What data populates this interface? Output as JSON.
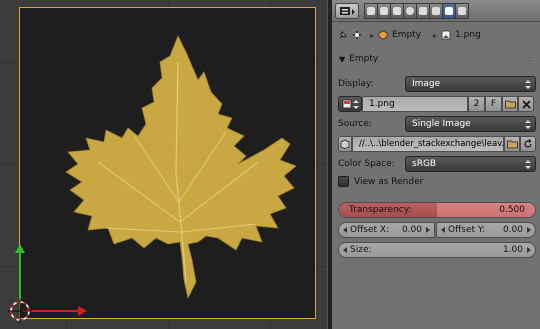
{
  "viewport": {
    "colors": {
      "background": "#3c3c3c",
      "frame": "#e8a02e",
      "leaf": "#c9a844",
      "y_axis": "#2ec026",
      "x_axis": "#d41e1e"
    }
  },
  "breadcrumb": {
    "object_icon": "empty-axes-icon",
    "object_name": "Empty",
    "image_icon": "image-icon",
    "image_name": "1.png"
  },
  "panel": {
    "section_title": "Empty",
    "display_label": "Display:",
    "display_value": "Image",
    "image_name": "1.png",
    "users_count": "2",
    "fake_user": "F",
    "source_label": "Source:",
    "source_value": "Single Image",
    "filepath": "//..\\..\\blender_stackexchange\\leav...",
    "color_space_label": "Color Space:",
    "color_space_value": "sRGB",
    "view_as_render_label": "View as Render",
    "view_as_render_checked": false,
    "transparency_label": "Transparency:",
    "transparency_value": "0.500",
    "transparency_fraction": 0.5,
    "offset_x_label": "Offset X:",
    "offset_x_value": "0.00",
    "offset_y_label": "Offset Y:",
    "offset_y_value": "0.00",
    "size_label": "Size:",
    "size_value": "1.00"
  },
  "accent": {
    "slider": "#cc7171",
    "active_tab": "#4d6f9f"
  }
}
